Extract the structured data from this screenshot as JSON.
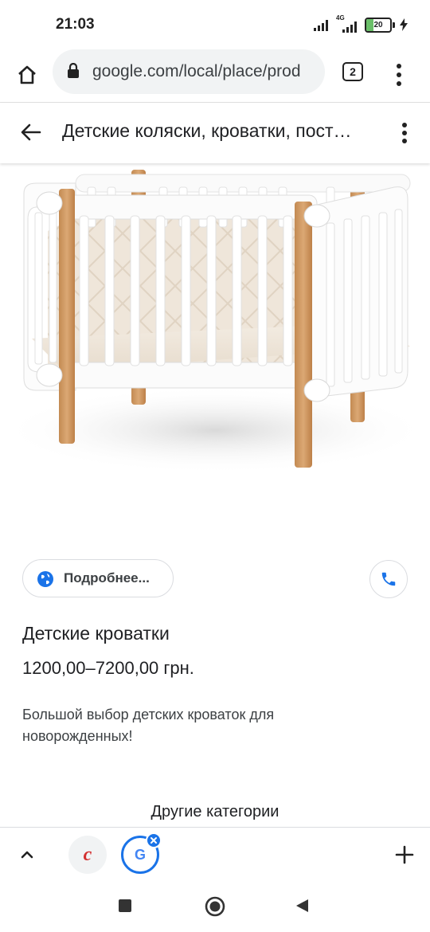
{
  "status_bar": {
    "time": "21:03",
    "network_label": "4G",
    "battery_level": "20",
    "icons": [
      "signal-icon",
      "signal-4g-icon",
      "battery-icon",
      "charging-icon"
    ]
  },
  "browser": {
    "url": "google.com/local/place/prod",
    "tab_count": "2",
    "icons": [
      "home-icon",
      "lock-icon",
      "tabs-icon",
      "more-vert-icon"
    ]
  },
  "place_header": {
    "title": "Детские коляски, кроватки, пост…",
    "icons": [
      "back-arrow-icon",
      "more-vert-icon"
    ]
  },
  "product": {
    "image_subject": "crib-image",
    "details_button": "Подробнее...",
    "name": "Детские кроватки",
    "price": "1200,00–7200,00 грн.",
    "description": "Большой выбор детских кроваток для новорожденных!",
    "icons": [
      "globe-icon",
      "phone-icon"
    ]
  },
  "other_categories_heading": "Другие категории",
  "tab_strip": {
    "tabs": [
      {
        "letter": "c",
        "active": false
      },
      {
        "letter": "G",
        "active": true
      }
    ],
    "icons": [
      "chevron-up-icon",
      "close-icon",
      "plus-icon"
    ]
  },
  "nav_bar": {
    "icons": [
      "recents-icon",
      "home-circle-icon",
      "back-triangle-icon"
    ]
  },
  "colors": {
    "accent": "#1a73e8",
    "text": "#202124",
    "chip_border": "#dadce0",
    "url_bg": "#f1f3f4",
    "crib_wood": "#cf9a62",
    "c_icon": "#d32f2f"
  }
}
